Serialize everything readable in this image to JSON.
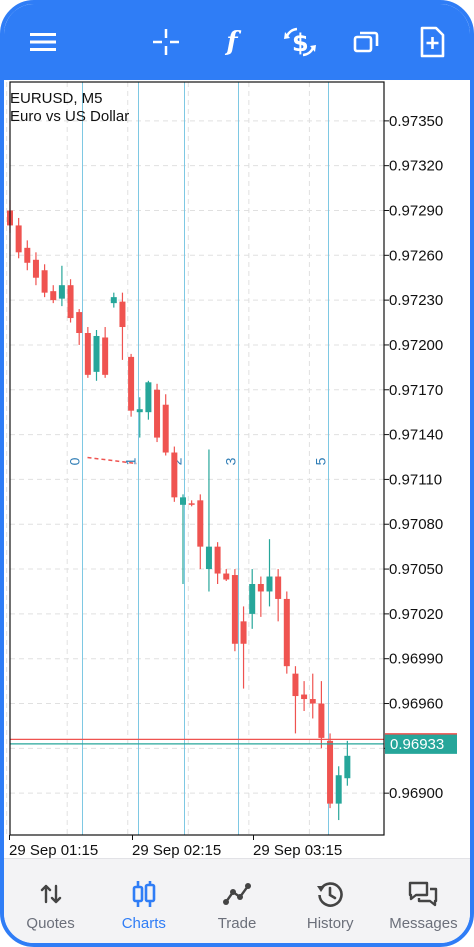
{
  "colors": {
    "accent": "#2f7df6",
    "bull": "#26a69a",
    "bear": "#ef5350",
    "vline": "#7ec8e3",
    "grid": "#e0e0e0",
    "ask": "#ef5350",
    "bid": "#26a69a"
  },
  "toolbar": {
    "menu_icon": "hamburger-menu-icon",
    "crosshair_icon": "crosshair-icon",
    "function_label": "f",
    "trade_icon": "dollar-exchange-icon",
    "window_icon": "windows-icon",
    "new_order_icon": "add-document-icon"
  },
  "chart": {
    "symbol": "EURUSD, M5",
    "description": "Euro vs US Dollar",
    "current_price_label": "0.96933"
  },
  "chart_data": {
    "type": "candlestick",
    "ylim": [
      0.96872,
      0.97376
    ],
    "y_ticks": [
      "0.97350",
      "0.97320",
      "0.97290",
      "0.97260",
      "0.97230",
      "0.97200",
      "0.97170",
      "0.97140",
      "0.97110",
      "0.97080",
      "0.97050",
      "0.97020",
      "0.96990",
      "0.96960",
      "0.96930",
      "0.96900"
    ],
    "x_ticks": [
      "29 Sep 01:15",
      "29 Sep 02:15",
      "29 Sep 03:15"
    ],
    "bid": 0.96933,
    "ask": 0.96936,
    "candles": [
      [
        0.9729,
        0.97297,
        0.97275,
        0.9728
      ],
      [
        0.9728,
        0.97285,
        0.97258,
        0.97262
      ],
      [
        0.97265,
        0.9727,
        0.9725,
        0.97255
      ],
      [
        0.97257,
        0.97262,
        0.9724,
        0.97245
      ],
      [
        0.9725,
        0.97254,
        0.97232,
        0.97235
      ],
      [
        0.97236,
        0.9724,
        0.97228,
        0.9723
      ],
      [
        0.97231,
        0.97253,
        0.97226,
        0.9724
      ],
      [
        0.9724,
        0.97244,
        0.97215,
        0.97218
      ],
      [
        0.97222,
        0.97224,
        0.972,
        0.97208
      ],
      [
        0.97208,
        0.97212,
        0.97178,
        0.9718
      ],
      [
        0.97182,
        0.9721,
        0.97176,
        0.97206
      ],
      [
        0.97205,
        0.97212,
        0.97178,
        0.9718
      ],
      [
        0.97228,
        0.97235,
        0.97225,
        0.97232
      ],
      [
        0.97229,
        0.97235,
        0.9719,
        0.97212
      ],
      [
        0.97192,
        0.97194,
        0.97152,
        0.97156
      ],
      [
        0.97155,
        0.97165,
        0.97138,
        0.97157
      ],
      [
        0.97155,
        0.97176,
        0.9715,
        0.97175
      ],
      [
        0.9717,
        0.97174,
        0.97135,
        0.97138
      ],
      [
        0.9716,
        0.97167,
        0.97126,
        0.97128
      ],
      [
        0.97128,
        0.97132,
        0.97095,
        0.97098
      ],
      [
        0.97093,
        0.971,
        0.9704,
        0.97098
      ],
      [
        0.97094,
        0.97096,
        0.97092,
        0.97093
      ],
      [
        0.97096,
        0.971,
        0.9705,
        0.97065
      ],
      [
        0.9705,
        0.9713,
        0.97035,
        0.97065
      ],
      [
        0.97065,
        0.97068,
        0.9704,
        0.97047
      ],
      [
        0.97047,
        0.9705,
        0.97042,
        0.97043
      ],
      [
        0.97046,
        0.9705,
        0.96995,
        0.97
      ],
      [
        0.97015,
        0.97025,
        0.9697,
        0.97
      ],
      [
        0.9702,
        0.9705,
        0.9701,
        0.9704
      ],
      [
        0.9704,
        0.97045,
        0.97018,
        0.97035
      ],
      [
        0.97035,
        0.9707,
        0.97025,
        0.97045
      ],
      [
        0.97045,
        0.9705,
        0.97015,
        0.9703
      ],
      [
        0.9703,
        0.97035,
        0.9698,
        0.96985
      ],
      [
        0.9698,
        0.96985,
        0.9694,
        0.96965
      ],
      [
        0.96966,
        0.96975,
        0.96955,
        0.96963
      ],
      [
        0.96963,
        0.9698,
        0.9695,
        0.9696
      ],
      [
        0.9696,
        0.96975,
        0.9693,
        0.96937
      ],
      [
        0.96935,
        0.9694,
        0.9689,
        0.96893
      ],
      [
        0.96893,
        0.96918,
        0.96882,
        0.96912
      ],
      [
        0.9691,
        0.96935,
        0.96905,
        0.96925
      ]
    ],
    "vertical_lines": [
      {
        "label": "0",
        "index": 7.5
      },
      {
        "label": "1",
        "index": 14.0
      },
      {
        "label": "2",
        "index": 19.3
      },
      {
        "label": "3",
        "index": 25.5
      },
      {
        "label": "5",
        "index": 36.0
      }
    ],
    "line_labels_price": 0.97122
  },
  "nav": {
    "items": [
      {
        "label": "Quotes",
        "icon": "quotes-arrows-icon"
      },
      {
        "label": "Charts",
        "icon": "charts-candles-icon"
      },
      {
        "label": "Trade",
        "icon": "trade-line-icon"
      },
      {
        "label": "History",
        "icon": "history-clock-icon"
      },
      {
        "label": "Messages",
        "icon": "messages-bubbles-icon"
      }
    ],
    "active": "Charts"
  }
}
